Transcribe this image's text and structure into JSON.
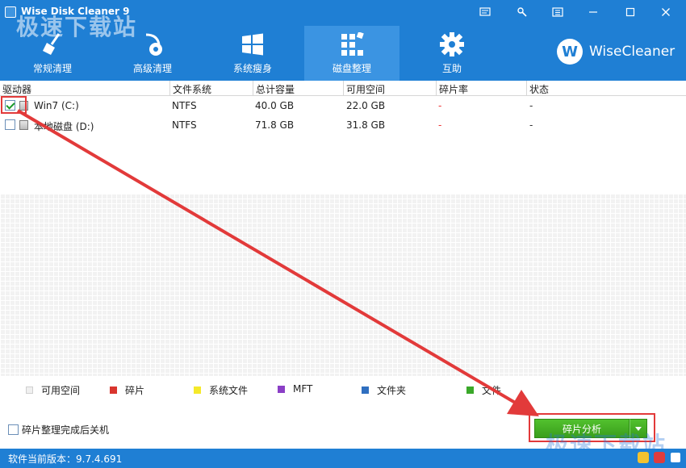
{
  "window": {
    "title": "Wise Disk Cleaner 9",
    "watermark": "极速下载站"
  },
  "tabs": [
    {
      "label": "常规清理",
      "icon": "broom-icon",
      "active": false
    },
    {
      "label": "高级清理",
      "icon": "vacuum-icon",
      "active": false
    },
    {
      "label": "系统瘦身",
      "icon": "windows-icon",
      "active": false
    },
    {
      "label": "磁盘整理",
      "icon": "defrag-blocks-icon",
      "active": true
    },
    {
      "label": "互助",
      "icon": "gear-icon",
      "active": false
    }
  ],
  "brand": {
    "logo_letter": "W",
    "name": "WiseCleaner"
  },
  "table": {
    "headers": [
      "驱动器",
      "文件系统",
      "总计容量",
      "可用空间",
      "碎片率",
      "状态"
    ],
    "rows": [
      {
        "checked": true,
        "drive": "Win7 (C:)",
        "fs": "NTFS",
        "total": "40.0 GB",
        "free": "22.0 GB",
        "frag": "-",
        "status": "-"
      },
      {
        "checked": false,
        "drive": "本地磁盘 (D:)",
        "fs": "NTFS",
        "total": "71.8 GB",
        "free": "31.8 GB",
        "frag": "-",
        "status": "-"
      }
    ]
  },
  "legend": [
    {
      "label": "可用空间",
      "color": "#f0f0f0"
    },
    {
      "label": "碎片",
      "color": "#d9352e"
    },
    {
      "label": "系统文件",
      "color": "#f5e92a"
    },
    {
      "label": "MFT",
      "color": "#8b3fc6"
    },
    {
      "label": "文件夹",
      "color": "#2f6fc0"
    },
    {
      "label": "文件",
      "color": "#3aa829"
    }
  ],
  "footer": {
    "shutdown_label": "碎片整理完成后关机",
    "shutdown_checked": false,
    "analyze_label": "碎片分析"
  },
  "status": {
    "version_text": "软件当前版本：9.7.4.691"
  },
  "colors": {
    "header_bg": "#1f7fd4",
    "active_tab": "#3b94e2",
    "analyze_green": "#45b024",
    "annotation_red": "#e23a3a"
  }
}
